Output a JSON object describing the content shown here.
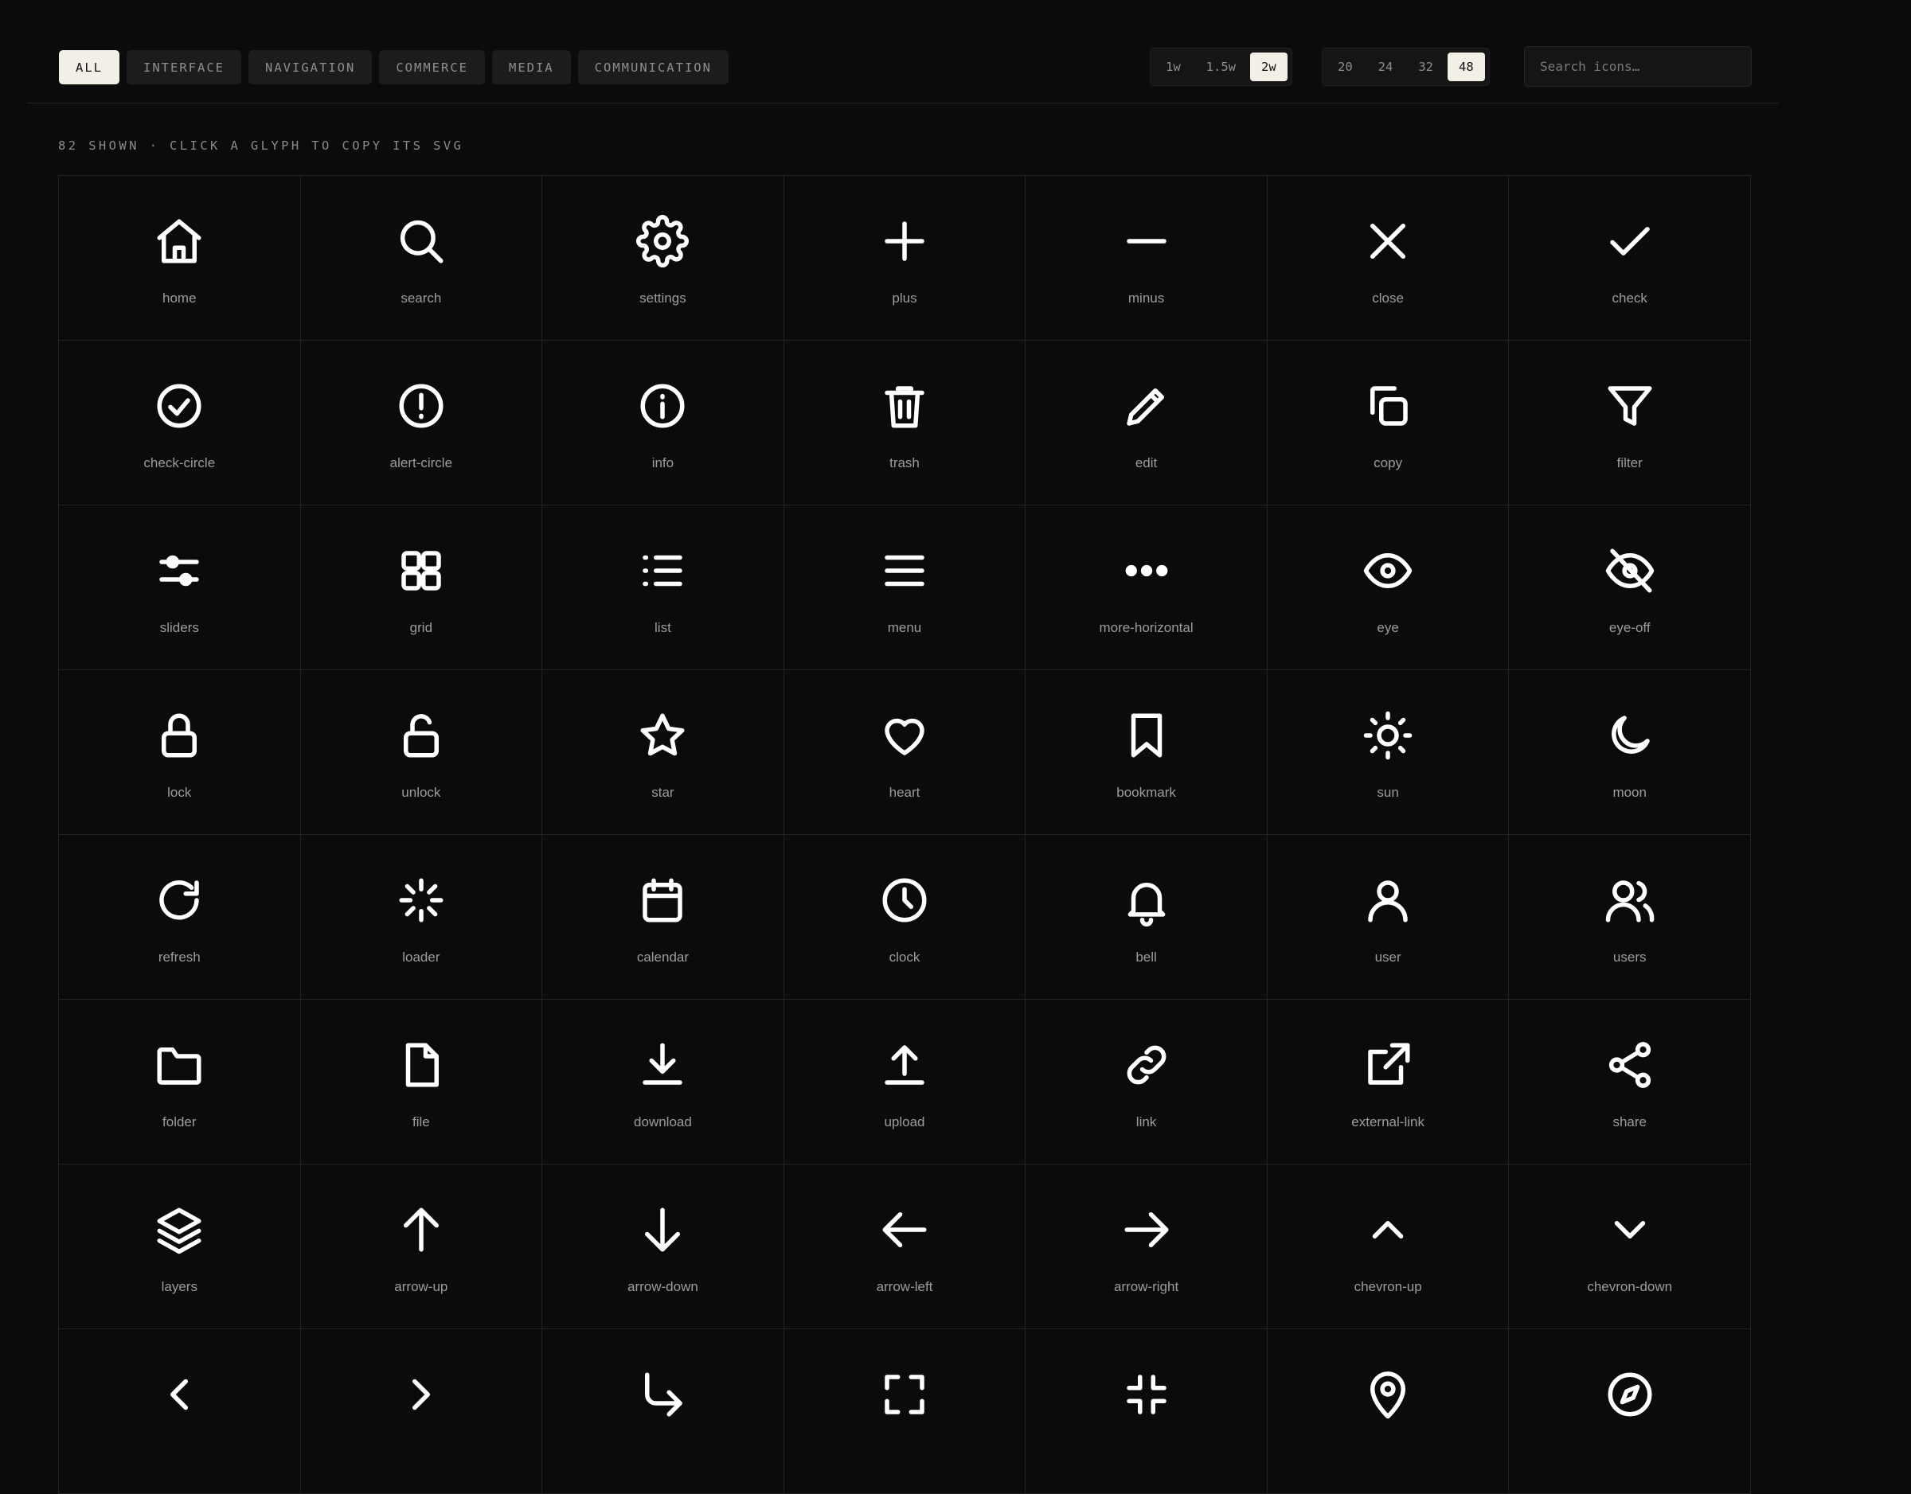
{
  "categories": [
    "ALL",
    "INTERFACE",
    "NAVIGATION",
    "COMMERCE",
    "MEDIA",
    "COMMUNICATION"
  ],
  "active_category": "ALL",
  "stroke_weights": [
    "1w",
    "1.5w",
    "2w"
  ],
  "active_weight": "2w",
  "sizes": [
    "20",
    "24",
    "32",
    "48"
  ],
  "active_size": "48",
  "search": {
    "placeholder": "Search icons…"
  },
  "status_text": "82 SHOWN · CLICK A GLYPH TO COPY ITS SVG",
  "icons": [
    {
      "name": "home"
    },
    {
      "name": "search"
    },
    {
      "name": "settings"
    },
    {
      "name": "plus"
    },
    {
      "name": "minus"
    },
    {
      "name": "close"
    },
    {
      "name": "check"
    },
    {
      "name": "check-circle"
    },
    {
      "name": "alert-circle"
    },
    {
      "name": "info"
    },
    {
      "name": "trash"
    },
    {
      "name": "edit"
    },
    {
      "name": "copy"
    },
    {
      "name": "filter"
    },
    {
      "name": "sliders"
    },
    {
      "name": "grid"
    },
    {
      "name": "list"
    },
    {
      "name": "menu"
    },
    {
      "name": "more-horizontal"
    },
    {
      "name": "eye"
    },
    {
      "name": "eye-off"
    },
    {
      "name": "lock"
    },
    {
      "name": "unlock"
    },
    {
      "name": "star"
    },
    {
      "name": "heart"
    },
    {
      "name": "bookmark"
    },
    {
      "name": "sun"
    },
    {
      "name": "moon"
    },
    {
      "name": "refresh"
    },
    {
      "name": "loader"
    },
    {
      "name": "calendar"
    },
    {
      "name": "clock"
    },
    {
      "name": "bell"
    },
    {
      "name": "user"
    },
    {
      "name": "users"
    },
    {
      "name": "folder"
    },
    {
      "name": "file"
    },
    {
      "name": "download"
    },
    {
      "name": "upload"
    },
    {
      "name": "link"
    },
    {
      "name": "external-link"
    },
    {
      "name": "share"
    },
    {
      "name": "layers"
    },
    {
      "name": "arrow-up"
    },
    {
      "name": "arrow-down"
    },
    {
      "name": "arrow-left"
    },
    {
      "name": "arrow-right"
    },
    {
      "name": "chevron-up"
    },
    {
      "name": "chevron-down"
    },
    {
      "name": "chevron-left",
      "label": ""
    },
    {
      "name": "chevron-right",
      "label": ""
    },
    {
      "name": "corner-down-right",
      "label": ""
    },
    {
      "name": "maximize",
      "label": ""
    },
    {
      "name": "minimize",
      "label": ""
    },
    {
      "name": "map-pin",
      "label": ""
    },
    {
      "name": "compass",
      "label": ""
    }
  ]
}
